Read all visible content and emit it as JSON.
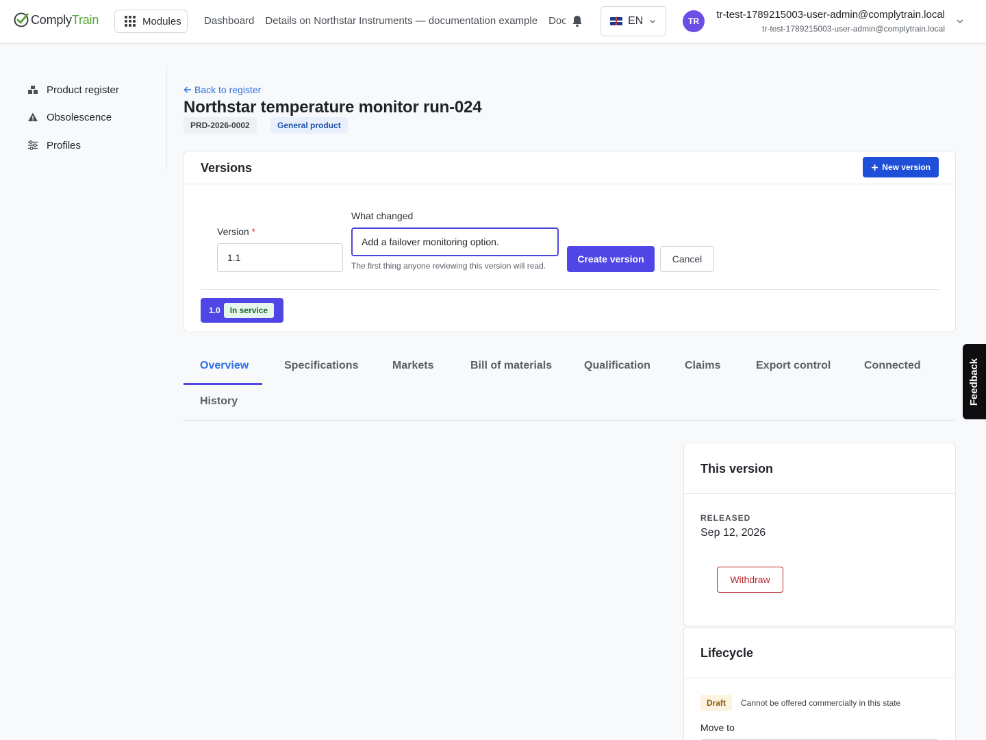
{
  "brand": {
    "name_part1": "Comply",
    "name_part2": "Train"
  },
  "topbar": {
    "modules_label": "Modules",
    "breadcrumbs": [
      "Dashboard",
      "Details on Northstar Instruments — documentation example",
      "Documentation"
    ],
    "language": "EN",
    "avatar_initials": "TR",
    "user_name": "tr-test-1789215003-user-admin@complytrain.local",
    "user_email": "tr-test-1789215003-user-admin@complytrain.local"
  },
  "sidebar": {
    "items": [
      {
        "label": "Product register",
        "icon": "boxes-icon"
      },
      {
        "label": "Obsolescence",
        "icon": "warning-icon"
      },
      {
        "label": "Profiles",
        "icon": "sliders-icon"
      }
    ]
  },
  "product": {
    "back_label": "Back to register",
    "title": "Northstar temperature monitor run-024",
    "id": "PRD-2026-0002",
    "type": "General product"
  },
  "versions": {
    "title": "Versions",
    "new_version_label": "New version",
    "form": {
      "version_label": "Version",
      "version_value": "1.1",
      "what_changed_label": "What changed",
      "what_changed_value": "Add a failover monitoring option.",
      "what_changed_hint": "The first thing anyone reviewing this version will read.",
      "create_label": "Create version",
      "cancel_label": "Cancel"
    },
    "list": [
      {
        "version": "1.0",
        "status": "In service"
      }
    ]
  },
  "tabs": [
    "Overview",
    "Specifications",
    "Markets",
    "Bill of materials",
    "Qualification",
    "Claims",
    "Export control",
    "Connected",
    "History"
  ],
  "active_tab": "Overview",
  "feedback_label": "Feedback",
  "this_version": {
    "title": "This version",
    "released_label": "RELEASED",
    "released_date": "Sep 12, 2026",
    "withdraw_label": "Withdraw"
  },
  "lifecycle": {
    "title": "Lifecycle",
    "state": "Draft",
    "state_note": "Cannot be offered commercially in this state",
    "move_to_label": "Move to"
  },
  "colors": {
    "primary": "#4f46e5",
    "link": "#2f6fe0",
    "brand_green": "#59a538",
    "danger": "#b8262a"
  }
}
